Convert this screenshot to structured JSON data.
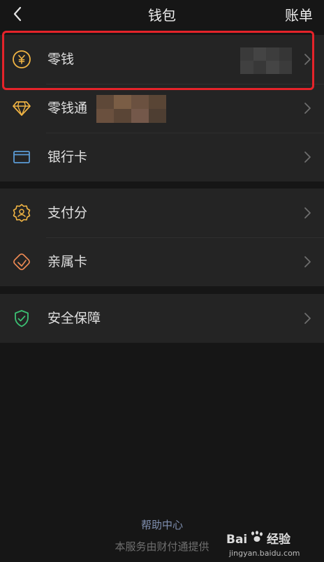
{
  "header": {
    "title": "钱包",
    "right_label": "账单"
  },
  "sections": [
    {
      "items": [
        {
          "label": "零钱"
        },
        {
          "label": "零钱通"
        },
        {
          "label": "银行卡"
        }
      ]
    },
    {
      "items": [
        {
          "label": "支付分"
        },
        {
          "label": "亲属卡"
        }
      ]
    },
    {
      "items": [
        {
          "label": "安全保障"
        }
      ]
    }
  ],
  "footer": {
    "help": "帮助中心",
    "provider": "本服务由财付通提供"
  },
  "watermark": {
    "brand": "Bai 经验",
    "url": "jingyan.baidu.com"
  },
  "colors": {
    "background": "#161616",
    "row_background": "#242424",
    "highlight": "#e5232a",
    "icon_yellow": "#f2b544",
    "icon_blue": "#5b9bd5",
    "icon_orange": "#ee8a54",
    "icon_green": "#3cbf73"
  }
}
